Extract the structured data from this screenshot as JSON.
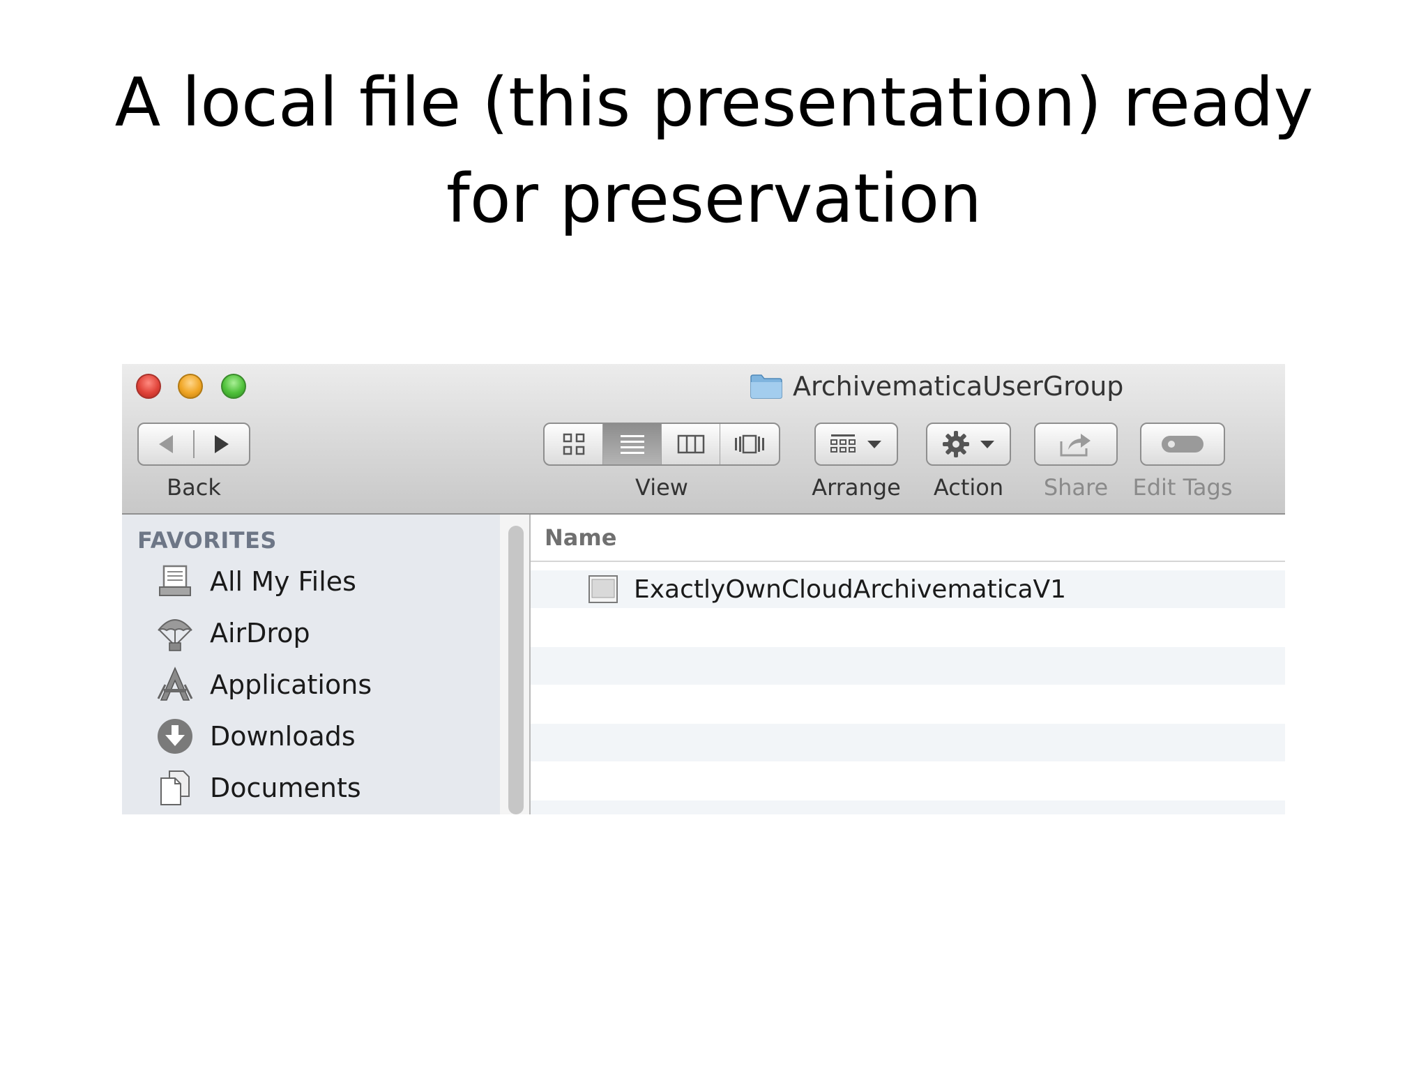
{
  "slide": {
    "title_line1": "A local file (this presentation) ready",
    "title_line2": "for preservation"
  },
  "window": {
    "title": "ArchivematicaUserGroup"
  },
  "toolbar": {
    "back_label": "Back",
    "view_label": "View",
    "arrange_label": "Arrange",
    "action_label": "Action",
    "share_label": "Share",
    "edit_tags_label": "Edit Tags",
    "active_view": "list"
  },
  "sidebar": {
    "heading": "FAVORITES",
    "items": [
      {
        "label": "All My Files",
        "icon": "all-my-files-icon"
      },
      {
        "label": "AirDrop",
        "icon": "airdrop-icon"
      },
      {
        "label": "Applications",
        "icon": "applications-icon"
      },
      {
        "label": "Downloads",
        "icon": "downloads-icon"
      },
      {
        "label": "Documents",
        "icon": "documents-icon"
      }
    ]
  },
  "file_list": {
    "column_name": "Name",
    "files": [
      {
        "name": "ExactlyOwnCloudArchivematicaV1",
        "icon": "document-file-icon"
      }
    ]
  },
  "colors": {
    "close": "#e0443a",
    "minimize": "#f0a626",
    "zoom": "#4fc03a",
    "sidebar_bg": "#e6e9ee",
    "sidebar_heading": "#6d7686",
    "folder_blue": "#8fc1e6"
  }
}
